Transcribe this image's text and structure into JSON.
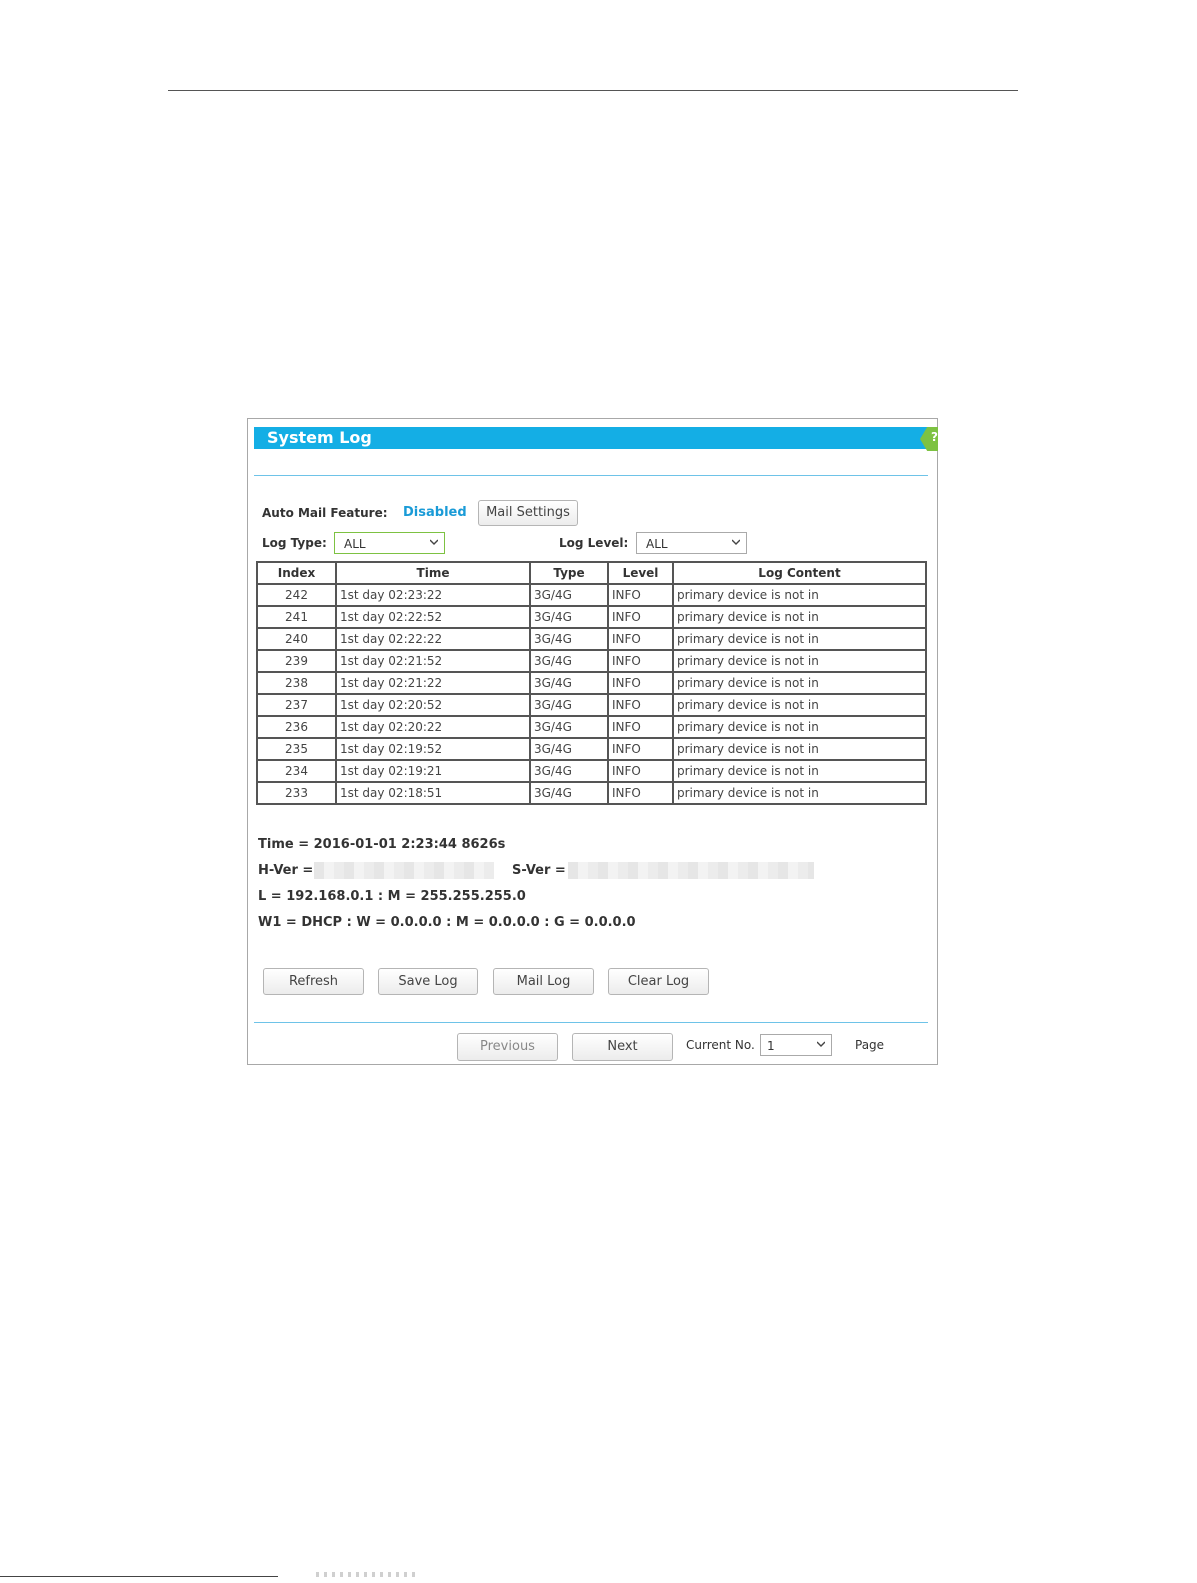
{
  "panel": {
    "title": "System Log",
    "help_label": "?"
  },
  "mail": {
    "label": "Auto Mail Feature:",
    "status": "Disabled",
    "settings_button": "Mail Settings"
  },
  "filters": {
    "log_type_label": "Log Type:",
    "log_type_value": "ALL",
    "log_level_label": "Log Level:",
    "log_level_value": "ALL"
  },
  "table": {
    "headers": [
      "Index",
      "Time",
      "Type",
      "Level",
      "Log Content"
    ],
    "rows": [
      [
        "242",
        "1st day 02:23:22",
        "3G/4G",
        "INFO",
        "primary device is not in"
      ],
      [
        "241",
        "1st day 02:22:52",
        "3G/4G",
        "INFO",
        "primary device is not in"
      ],
      [
        "240",
        "1st day 02:22:22",
        "3G/4G",
        "INFO",
        "primary device is not in"
      ],
      [
        "239",
        "1st day 02:21:52",
        "3G/4G",
        "INFO",
        "primary device is not in"
      ],
      [
        "238",
        "1st day 02:21:22",
        "3G/4G",
        "INFO",
        "primary device is not in"
      ],
      [
        "237",
        "1st day 02:20:52",
        "3G/4G",
        "INFO",
        "primary device is not in"
      ],
      [
        "236",
        "1st day 02:20:22",
        "3G/4G",
        "INFO",
        "primary device is not in"
      ],
      [
        "235",
        "1st day 02:19:52",
        "3G/4G",
        "INFO",
        "primary device is not in"
      ],
      [
        "234",
        "1st day 02:19:21",
        "3G/4G",
        "INFO",
        "primary device is not in"
      ],
      [
        "233",
        "1st day 02:18:51",
        "3G/4G",
        "INFO",
        "primary device is not in"
      ]
    ]
  },
  "info": {
    "time": "Time = 2016-01-01 2:23:44 8626s",
    "hver_label": "H-Ver =",
    "sver_label": "S-Ver =",
    "lan": "L = 192.168.0.1 : M = 255.255.255.0",
    "wan": "W1 = DHCP : W = 0.0.0.0 : M = 0.0.0.0 : G = 0.0.0.0"
  },
  "actions": {
    "refresh": "Refresh",
    "save_log": "Save Log",
    "mail_log": "Mail Log",
    "clear_log": "Clear Log"
  },
  "pagination": {
    "previous": "Previous",
    "next": "Next",
    "current_label": "Current No.",
    "current_value": "1",
    "page_label": "Page"
  },
  "colors": {
    "title_bar": "#14aee5",
    "disabled_status": "#1a9bd7",
    "help_tab": "#7dc242"
  }
}
